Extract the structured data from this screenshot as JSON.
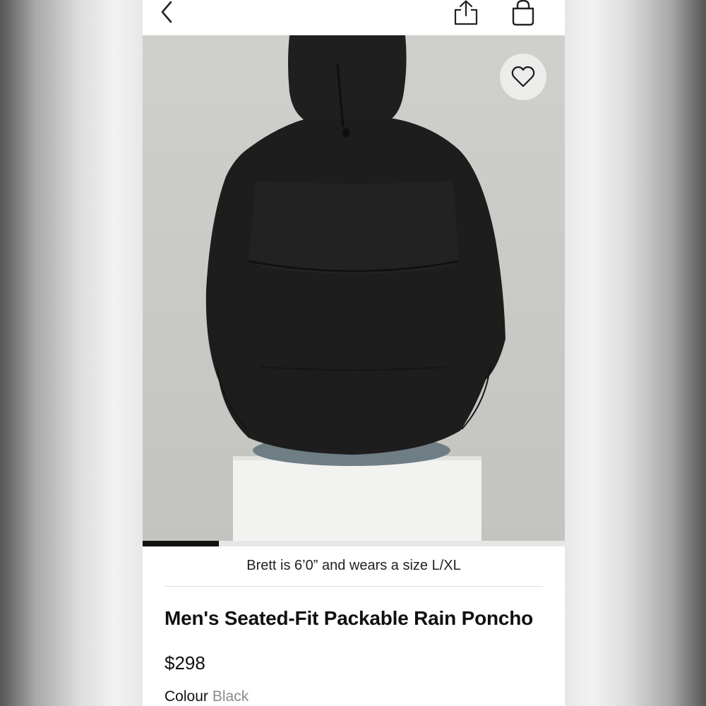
{
  "icons": {
    "back": "chevron-left-icon",
    "share": "share-icon",
    "bag": "shopping-bag-icon",
    "favorite": "heart-icon"
  },
  "gallery": {
    "progress_fraction": 0.18,
    "caption": "Brett is 6’0” and wears a size L/XL"
  },
  "product": {
    "title": "Men's Seated-Fit Packable Rain Poncho",
    "price": "$298",
    "colour_label": "Colour",
    "colour_value": "Black"
  },
  "colors": {
    "photo_background": "#c9cac6",
    "garment": "#1c1c1c",
    "accent": "#111111"
  }
}
